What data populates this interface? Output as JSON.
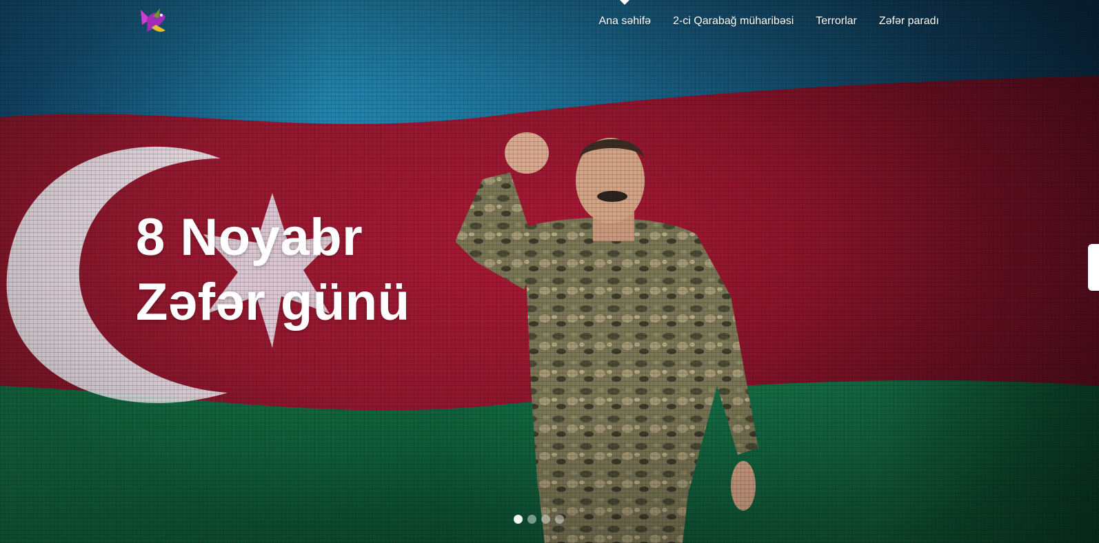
{
  "nav": {
    "logo_icon": "hummingbird-logo-icon",
    "items": [
      {
        "label": "Ana səhifə",
        "active": true
      },
      {
        "label": "2-ci Qarabağ müharibəsi",
        "active": false
      },
      {
        "label": "Terrorlar",
        "active": false
      },
      {
        "label": "Zəfər paradı",
        "active": false
      }
    ]
  },
  "hero": {
    "title_line1": "8 Noyabr",
    "title_line2": "Zəfər günü",
    "background": "azerbaijan-flag-with-leader-photo",
    "flag_colors": {
      "blue": "#1f7fb8",
      "red": "#c0223a",
      "green": "#1a8a55"
    }
  },
  "carousel": {
    "slides": 4,
    "active_index": 0
  }
}
